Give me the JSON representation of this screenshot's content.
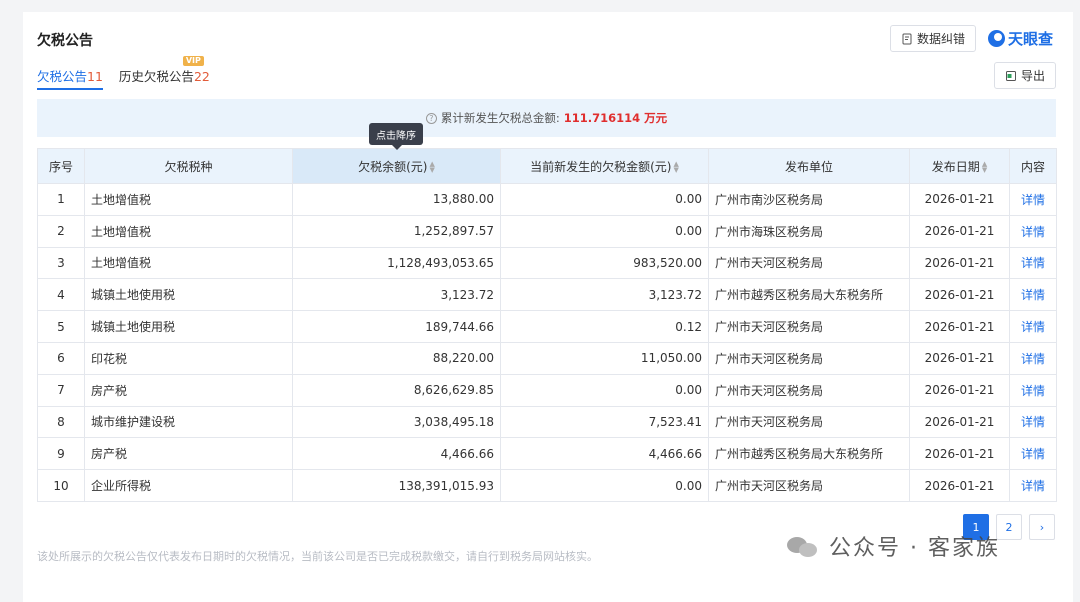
{
  "header": {
    "title": "欠税公告",
    "feedback_label": "数据纠错",
    "brand": "天眼查",
    "export_label": "导出"
  },
  "tabs": [
    {
      "label": "欠税公告",
      "count": "11"
    },
    {
      "label": "历史欠税公告",
      "count": "22",
      "badge": "VIP"
    }
  ],
  "summary": {
    "label": "累计新发生欠税总金额:",
    "amount": "111.716114 万元"
  },
  "tooltip": "点击降序",
  "table": {
    "columns": [
      "序号",
      "欠税税种",
      "欠税余额(元)",
      "当前新发生的欠税金额(元)",
      "发布单位",
      "发布日期",
      "内容"
    ],
    "rows": [
      {
        "idx": "1",
        "type": "土地增值税",
        "balance": "13,880.00",
        "new_amount": "0.00",
        "agency": "广州市南沙区税务局",
        "date": "2026-01-21",
        "action": "详情"
      },
      {
        "idx": "2",
        "type": "土地增值税",
        "balance": "1,252,897.57",
        "new_amount": "0.00",
        "agency": "广州市海珠区税务局",
        "date": "2026-01-21",
        "action": "详情"
      },
      {
        "idx": "3",
        "type": "土地增值税",
        "balance": "1,128,493,053.65",
        "new_amount": "983,520.00",
        "agency": "广州市天河区税务局",
        "date": "2026-01-21",
        "action": "详情"
      },
      {
        "idx": "4",
        "type": "城镇土地使用税",
        "balance": "3,123.72",
        "new_amount": "3,123.72",
        "agency": "广州市越秀区税务局大东税务所",
        "date": "2026-01-21",
        "action": "详情"
      },
      {
        "idx": "5",
        "type": "城镇土地使用税",
        "balance": "189,744.66",
        "new_amount": "0.12",
        "agency": "广州市天河区税务局",
        "date": "2026-01-21",
        "action": "详情"
      },
      {
        "idx": "6",
        "type": "印花税",
        "balance": "88,220.00",
        "new_amount": "11,050.00",
        "agency": "广州市天河区税务局",
        "date": "2026-01-21",
        "action": "详情"
      },
      {
        "idx": "7",
        "type": "房产税",
        "balance": "8,626,629.85",
        "new_amount": "0.00",
        "agency": "广州市天河区税务局",
        "date": "2026-01-21",
        "action": "详情"
      },
      {
        "idx": "8",
        "type": "城市维护建设税",
        "balance": "3,038,495.18",
        "new_amount": "7,523.41",
        "agency": "广州市天河区税务局",
        "date": "2026-01-21",
        "action": "详情"
      },
      {
        "idx": "9",
        "type": "房产税",
        "balance": "4,466.66",
        "new_amount": "4,466.66",
        "agency": "广州市越秀区税务局大东税务所",
        "date": "2026-01-21",
        "action": "详情"
      },
      {
        "idx": "10",
        "type": "企业所得税",
        "balance": "138,391,015.93",
        "new_amount": "0.00",
        "agency": "广州市天河区税务局",
        "date": "2026-01-21",
        "action": "详情"
      }
    ]
  },
  "pagination": {
    "pages": [
      "1",
      "2"
    ],
    "current": "1",
    "next": "›"
  },
  "footnote": "该处所展示的欠税公告仅代表发布日期时的欠税情况，当前该公司是否已完成税款缴交，请自行到税务局网站核实。",
  "watermark": "公众号 · 客家族",
  "colors": {
    "accent": "#1f6fe5",
    "amount": "#e02e2e",
    "count": "#e25c3a"
  }
}
